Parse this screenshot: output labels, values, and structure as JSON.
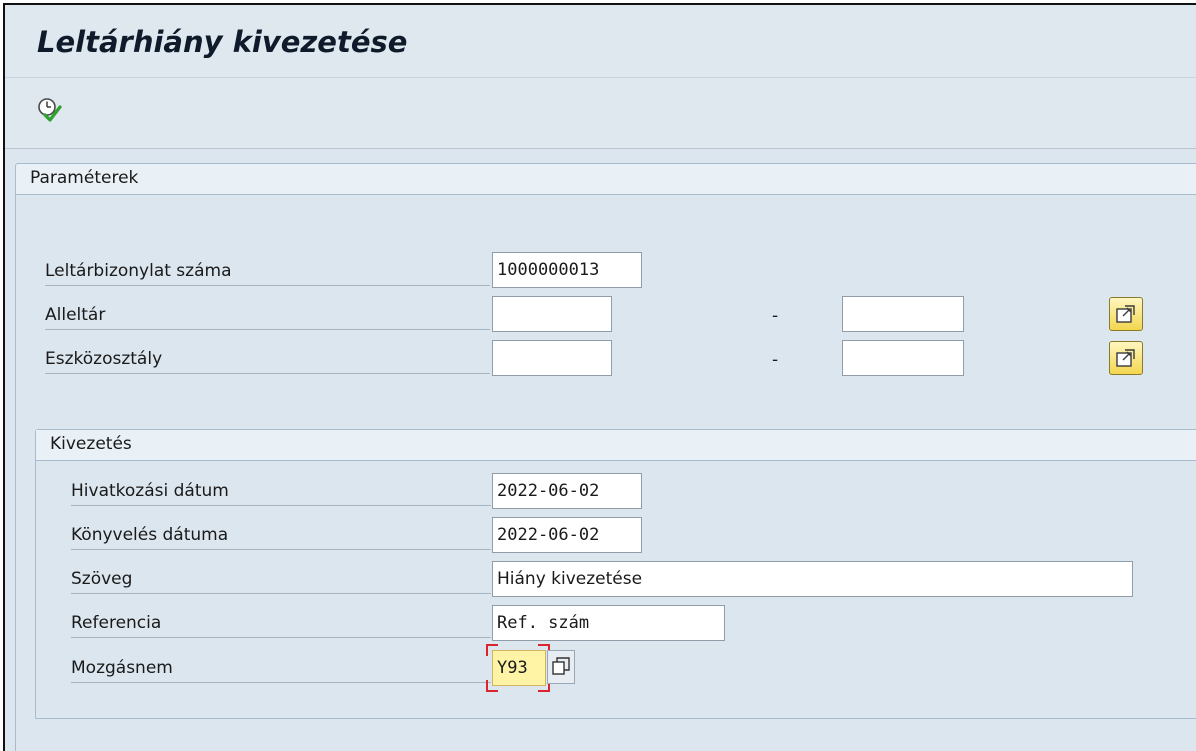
{
  "window": {
    "title": "Leltárhiány kivezetése"
  },
  "toolbar": {
    "execute_icon": "execute-icon"
  },
  "parameters": {
    "section_title": "Paraméterek",
    "leltarbizonylat": {
      "label": "Leltárbizonylat száma",
      "value": "1000000013"
    },
    "alleltar": {
      "label": "Alleltár",
      "from": "",
      "to": "",
      "separator": "-"
    },
    "eszkozosztaly": {
      "label": "Eszközosztály",
      "from": "",
      "to": "",
      "separator": "-"
    },
    "multiple_selection_icon": "multiple-selection-icon"
  },
  "kivezetes": {
    "section_title": "Kivezetés",
    "hivatkozasi_datum": {
      "label": "Hivatkozási dátum",
      "value": "2022-06-02"
    },
    "konyveles_datuma": {
      "label": "Könyvelés dátuma",
      "value": "2022-06-02"
    },
    "szoveg": {
      "label": "Szöveg",
      "value": "Hiány kivezetése"
    },
    "referencia": {
      "label": "Referencia",
      "value": "Ref. szám"
    },
    "mozgasnem": {
      "label": "Mozgásnem",
      "value": "Y93"
    }
  },
  "colors": {
    "background": "#dce6ee",
    "highlight": "#fff3a6",
    "focus": "#d9262c"
  }
}
